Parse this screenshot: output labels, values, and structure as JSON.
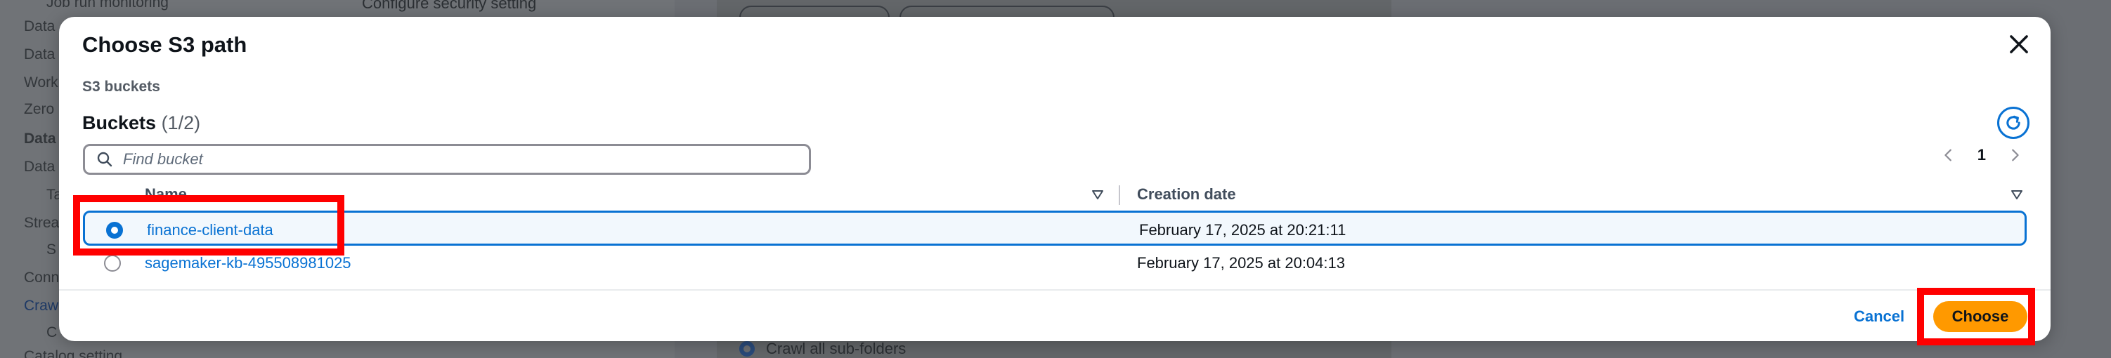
{
  "background": {
    "nav_items": [
      "Job run monitoring",
      "Data",
      "Data",
      "Work",
      "Zero",
      "Data",
      "Data",
      "Ta",
      "Strea",
      "S",
      "Conn",
      "Crawl",
      "C",
      "Catalog setting"
    ],
    "configure_security": "Configure security setting",
    "crawl_option": "Crawl all sub-folders"
  },
  "modal": {
    "title": "Choose S3 path",
    "section_label": "S3 buckets",
    "heading": "Buckets",
    "count": "(1/2)",
    "search_placeholder": "Find bucket",
    "page_number": "1",
    "columns": {
      "name": "Name",
      "date": "Creation date"
    },
    "rows": [
      {
        "name": "finance-client-data",
        "date": "February 17, 2025 at 20:21:11",
        "selected": true
      },
      {
        "name": "sagemaker-kb-495508981025",
        "date": "February 17, 2025 at 20:04:13",
        "selected": false
      }
    ],
    "cancel_label": "Cancel",
    "choose_label": "Choose"
  },
  "colors": {
    "accent": "#0972d3",
    "primary_button": "#ff9900",
    "highlight": "#ff0000"
  },
  "icons": [
    "close-icon",
    "refresh-icon",
    "search-icon",
    "chevron-left-icon",
    "chevron-right-icon",
    "sort-icon"
  ]
}
